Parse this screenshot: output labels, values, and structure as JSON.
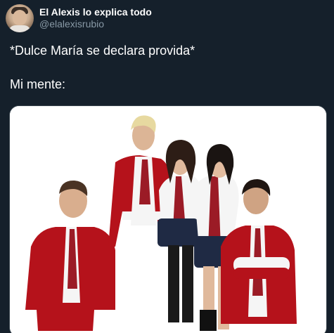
{
  "author": {
    "display_name": "El Alexis lo explica todo",
    "handle": "@elalexisrubio",
    "avatar_icon": "profile-photo"
  },
  "tweet": {
    "line1": "*Dulce María se declara provida*",
    "line2": "Mi mente:"
  },
  "media": {
    "description_icon": "photo-image",
    "uniform_color": "#b5121b",
    "tie_color": "#9b1b26",
    "background_color": "#ffffff"
  },
  "theme": {
    "background": "#15202b",
    "secondary_text": "#8899a6"
  }
}
